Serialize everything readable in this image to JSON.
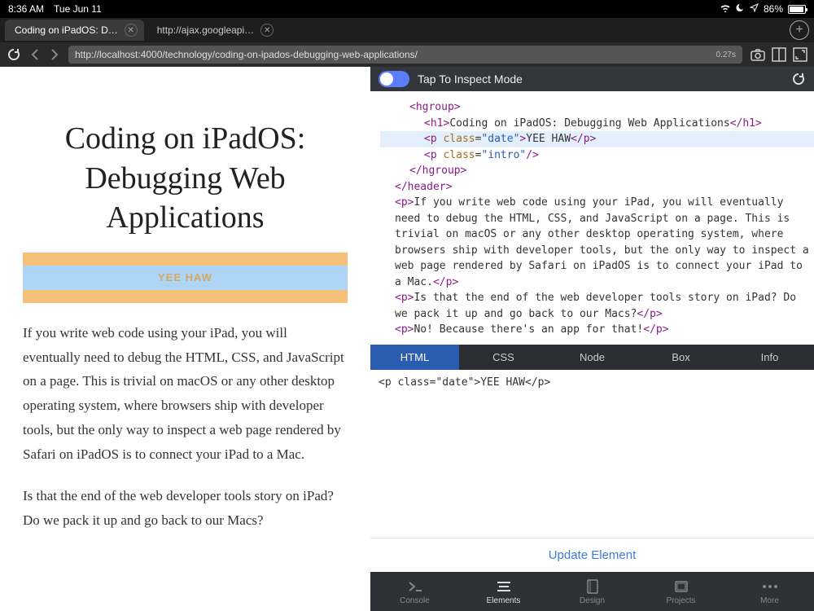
{
  "statusbar": {
    "time": "8:36 AM",
    "date": "Tue Jun 11",
    "battery_pct": "86%"
  },
  "tabs": [
    {
      "title": "Coding on iPadOS: D…",
      "active": true
    },
    {
      "title": "http://ajax.googleapi…",
      "active": false
    }
  ],
  "toolbar": {
    "url": "http://localhost:4000/technology/coding-on-ipados-debugging-web-applications/",
    "load_time": "0.27s"
  },
  "page": {
    "title": "Coding on iPadOS: Debugging Web Applications",
    "highlight_text": "YEE HAW",
    "p1": "If you write web code using your iPad, you will eventually need to debug the HTML, CSS, and JavaScript on a page. This is trivial on macOS or any other desktop operating system, where browsers ship with developer tools, but the only way to inspect a web page rendered by Safari on iPadOS is to connect your iPad to a Mac.",
    "p2": "Is that the end of the web developer tools story on iPad? Do we pack it up and go back to our Macs?"
  },
  "inspector": {
    "toggle_label": "Tap To Inspect Mode",
    "dom": {
      "hgroup_open": "<hgroup>",
      "h1_open": "<h1>",
      "h1_text": "Coding on iPadOS: Debugging Web Applications",
      "h1_close": "</h1>",
      "p_date": "<p class=\"date\">YEE HAW</p>",
      "p_intro": "<p class=\"intro\"/>",
      "hgroup_close": "</hgroup>",
      "header_close": "</header>",
      "p1_open": "<p>",
      "p1_text": "If you write web code using your iPad, you will eventually need to debug the HTML, CSS, and JavaScript on a page. This is trivial on macOS or any other desktop operating system, where browsers ship with developer tools, but the only way to inspect a web page rendered by Safari on iPadOS is to connect your iPad to a Mac.",
      "p1_close": "</p>",
      "p2_open": "<p>",
      "p2_text": "Is that the end of the web developer tools story on iPad? Do we pack it up and go back to our Macs?",
      "p2_close": "</p>",
      "p3_open": "<p>",
      "p3_text": "No! Because there's an app for that!",
      "p3_close": "</p>"
    },
    "tabs": [
      "HTML",
      "CSS",
      "Node",
      "Box",
      "Info"
    ],
    "active_tab": 0,
    "detail": "<p class=\"date\">YEE HAW</p>",
    "update_label": "Update Element"
  },
  "bottombar": [
    "Console",
    "Elements",
    "Design",
    "Projects",
    "More"
  ],
  "bottombar_active": 1
}
